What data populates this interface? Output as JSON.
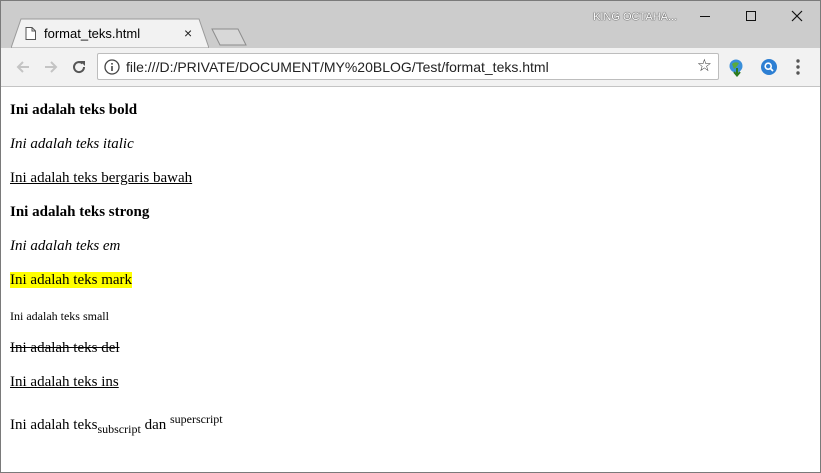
{
  "tab": {
    "title": "format_teks.html",
    "close": "×"
  },
  "window": {
    "user_name": "KING OCTAHA..."
  },
  "address_bar": {
    "url": "file:///D:/PRIVATE/DOCUMENT/MY%20BLOG/Test/format_teks.html"
  },
  "icons": {
    "page": "page-icon",
    "close": "close-icon",
    "minimize": "minimize-icon",
    "maximize": "maximize-icon",
    "window_close": "window-close-icon",
    "back": "back-arrow-icon",
    "forward": "forward-arrow-icon",
    "reload": "reload-icon",
    "info": "info-icon",
    "star": "star-icon",
    "globe": "globe-download-icon",
    "search": "search-extension-icon",
    "menu": "kebab-menu-icon"
  },
  "content": {
    "bold": "Ini adalah teks bold",
    "italic": "Ini adalah teks italic",
    "underline": "Ini adalah teks bergaris bawah",
    "strong": "Ini adalah teks strong",
    "em": "Ini adalah teks em",
    "mark": "Ini adalah teks mark",
    "small": "Ini adalah teks small",
    "del": "Ini adalah teks del",
    "ins": "Ini adalah teks ins",
    "sub_prefix": "Ini adalah teks",
    "subscript": "subscript",
    "sub_middle": " dan ",
    "superscript": "superscript"
  },
  "colors": {
    "mark_highlight": "#ffff00",
    "titlebar": "#cccccc",
    "toolbar": "#f2f2f2"
  }
}
